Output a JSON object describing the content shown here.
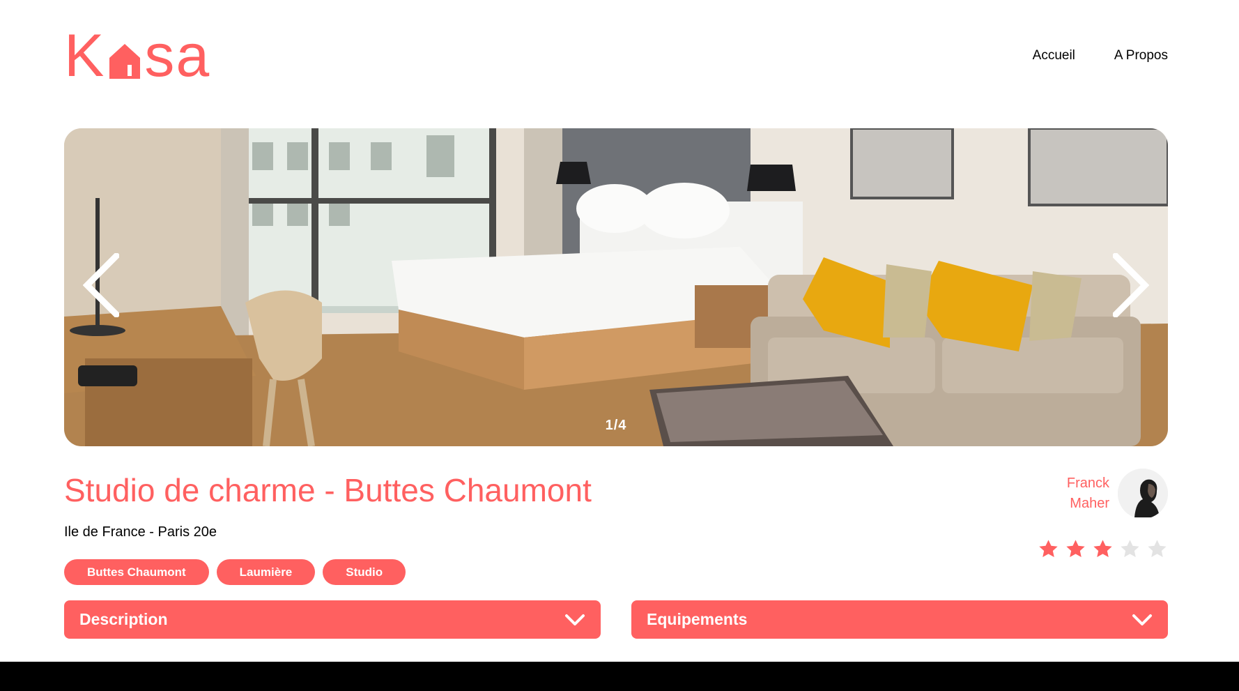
{
  "brand": {
    "logo_text_start": "K",
    "logo_text_end": "sa",
    "color": "#FF6060"
  },
  "nav": {
    "home": "Accueil",
    "about": "A Propos"
  },
  "carousel": {
    "counter": "1/4",
    "current": 1,
    "total": 4
  },
  "listing": {
    "title": "Studio de charme - Buttes Chaumont",
    "location": "Ile de France - Paris 20e",
    "tags": [
      "Buttes Chaumont",
      "Laumière",
      "Studio"
    ]
  },
  "host": {
    "first_name": "Franck",
    "last_name": "Maher"
  },
  "rating": {
    "value": 3,
    "max": 5,
    "active_color": "#FF6060",
    "inactive_color": "#E3E3E3"
  },
  "collapses": {
    "description": "Description",
    "equipment": "Equipements"
  },
  "icons": {
    "prev": "chevron-left-icon",
    "next": "chevron-right-icon",
    "collapse": "chevron-down-icon",
    "star": "star-icon"
  }
}
